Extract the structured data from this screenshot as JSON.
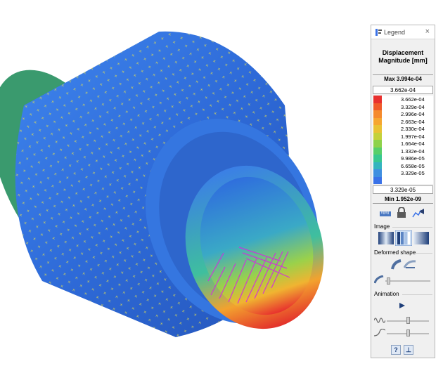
{
  "legend": {
    "window_title": "Legend",
    "close_glyph": "×",
    "title_line1": "Displacement",
    "title_line2": "Magnitude [mm]",
    "max_label": "Max",
    "max_value": "3.994e-04",
    "upper_limit": "3.662e-04",
    "lower_limit": "3.329e-05",
    "min_label": "Min",
    "min_value": "1.952e-09",
    "scale": [
      {
        "value": "3.662e-04",
        "color": "#e8302e"
      },
      {
        "value": "3.329e-04",
        "color": "#f05a2a"
      },
      {
        "value": "2.996e-04",
        "color": "#f58a2c"
      },
      {
        "value": "2.663e-04",
        "color": "#f6a630"
      },
      {
        "value": "2.330e-04",
        "color": "#e9c234"
      },
      {
        "value": "1.997e-04",
        "color": "#c4d13a"
      },
      {
        "value": "1.664e-04",
        "color": "#8ed24a"
      },
      {
        "value": "1.332e-04",
        "color": "#57cf6a"
      },
      {
        "value": "9.986e-05",
        "color": "#38c88f"
      },
      {
        "value": "6.658e-05",
        "color": "#34b4be"
      },
      {
        "value": "3.329e-05",
        "color": "#3f8fe0"
      },
      {
        "value": "",
        "color": "#3a72e8"
      }
    ],
    "sections": {
      "image": "Image",
      "deformed": "Deformed shape",
      "animation": "Animation"
    },
    "help_glyph": "?",
    "dock_glyph": "⊥"
  },
  "icons": [
    "ruler-icon",
    "lock-icon",
    "probe-icon",
    "gradient-smooth-icon",
    "gradient-banded-icon",
    "gradient-mixed-icon",
    "deformed-shape-icon",
    "undeformed-overlay-icon",
    "scale-slider-icon",
    "play-icon",
    "amplitude-icon",
    "frames-icon",
    "help-icon",
    "dock-icon"
  ]
}
